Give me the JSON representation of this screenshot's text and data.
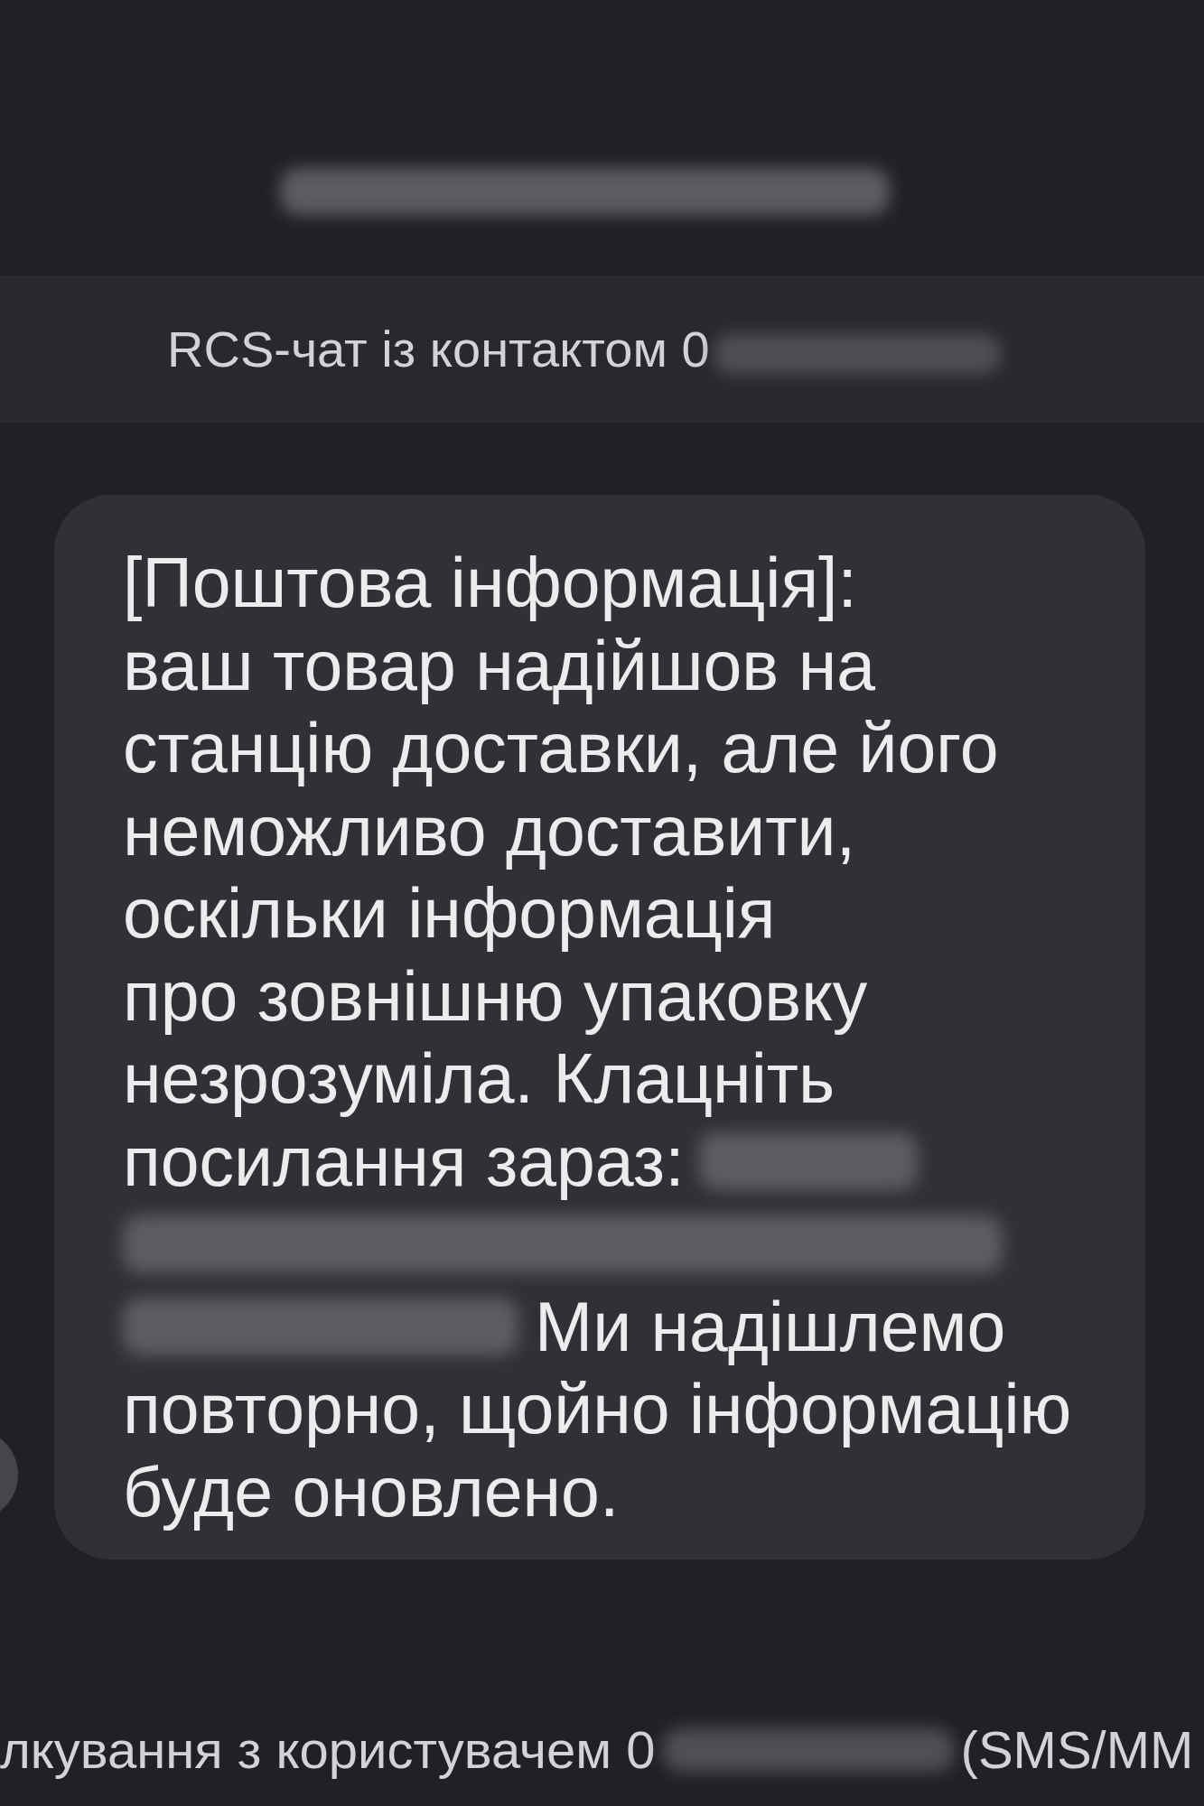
{
  "header": {
    "chat_label": "RCS-чат із контактом 0"
  },
  "message": {
    "text_before": "[Поштова інформація]:\nваш товар надійшов на\nстанцію доставки, але його\nнеможливо доставити,\nоскільки інформація\nпро зовнішню упаковку\nнезрозуміла. Клацніть",
    "link_lead": "посилання зараз:",
    "text_resume": "Ми надішлемо",
    "text_after": "повторно, щойно інформацію\nбуде оновлено."
  },
  "footer": {
    "chat_label": "лкування з користувачем 0",
    "channel_note": "(SMS/MM"
  }
}
